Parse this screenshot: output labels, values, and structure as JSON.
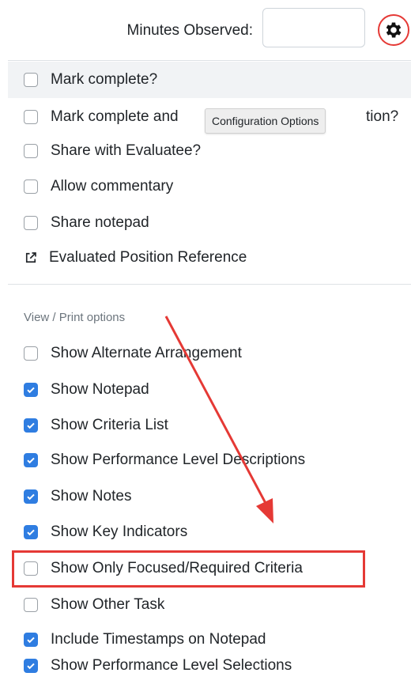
{
  "header": {
    "minutes_label": "Minutes Observed:",
    "minutes_value": "",
    "settings_icon": "gear-icon"
  },
  "tooltip": {
    "text": "Configuration Options"
  },
  "menu": {
    "items": [
      {
        "label": "Mark complete?",
        "checked": false
      },
      {
        "label": "Mark complete and ",
        "suffix": "tion?",
        "checked": false
      },
      {
        "label": "Share with Evaluatee?",
        "checked": false
      },
      {
        "label": "Allow commentary",
        "checked": false
      },
      {
        "label": "Share notepad",
        "checked": false
      }
    ],
    "link": {
      "label": "Evaluated Position Reference",
      "icon": "external-link-icon"
    }
  },
  "view_print": {
    "header": "View / Print options",
    "options": [
      {
        "label": "Show Alternate Arrangement",
        "checked": false
      },
      {
        "label": "Show Notepad",
        "checked": true
      },
      {
        "label": "Show Criteria List",
        "checked": true
      },
      {
        "label": "Show Performance Level Descriptions",
        "checked": true
      },
      {
        "label": "Show Notes",
        "checked": true
      },
      {
        "label": "Show Key Indicators",
        "checked": true
      },
      {
        "label": "Show Only Focused/Required Criteria",
        "checked": false
      },
      {
        "label": "Show Other Task",
        "checked": false
      },
      {
        "label": "Include Timestamps on Notepad",
        "checked": true
      },
      {
        "label": "Show Performance Level Selections",
        "checked": true
      }
    ]
  },
  "colors": {
    "accent": "#2f7de1",
    "annotation": "#e53935"
  }
}
